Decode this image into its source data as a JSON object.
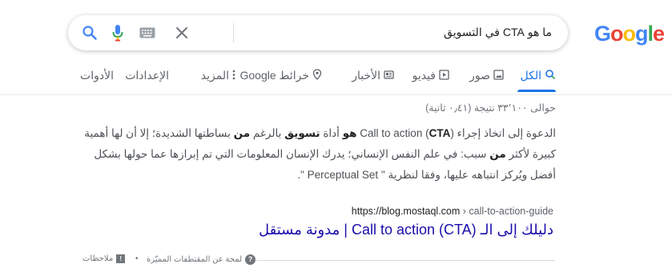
{
  "logo": {
    "letters": [
      "G",
      "o",
      "o",
      "g",
      "l",
      "e"
    ]
  },
  "search": {
    "query": "ما هو CTA في التسويق"
  },
  "tabs": {
    "all": "الكل",
    "images": "صور",
    "videos": "فيديو",
    "news": "الأخبار",
    "maps": "خرائط Google",
    "more": "المزيد",
    "settings": "الإعدادات",
    "tools": "الأدوات"
  },
  "results": {
    "stats": "حوالى ٣٣٬١٠٠ نتيجة (٠٫٤١ ثانية)",
    "snippet": {
      "p1": "الدعوة إلى اتخاذ إجراء (",
      "b1": "CTA",
      "p2": ") Call to action ",
      "b2": "هو",
      "p3": " أداة ",
      "b3": "تسويق",
      "p4": " بالرغم ",
      "b4": "من",
      "p5": " بساطتها الشديدة؛ إلا أن لها أهمية كبيرة لأكثر ",
      "b5": "من",
      "p6": " سبب: في علم النفس الإنساني؛ يدرك الإنسان المعلومات التي تم إبرازها عما حولها بشكل أفضل ويُركز انتباهه عليها، وفقا لنظرية \" Perceptual Set \"."
    },
    "cite_domain": "https://blog.mostaql.com",
    "cite_path": " › call-to-action-guide",
    "title": "دليلك إلى الـ Call to action (CTA) | مدونة مستقل"
  },
  "footer": {
    "about": "لمحة عن المقتطفات المميّزة",
    "separator": "•",
    "feedback": "ملاحظات"
  },
  "colors": {
    "blue": "#4285f4",
    "red": "#ea4335",
    "yellow": "#fbbc05",
    "green": "#34a853",
    "link": "#1a0dab",
    "active_tab": "#1a73e8"
  }
}
